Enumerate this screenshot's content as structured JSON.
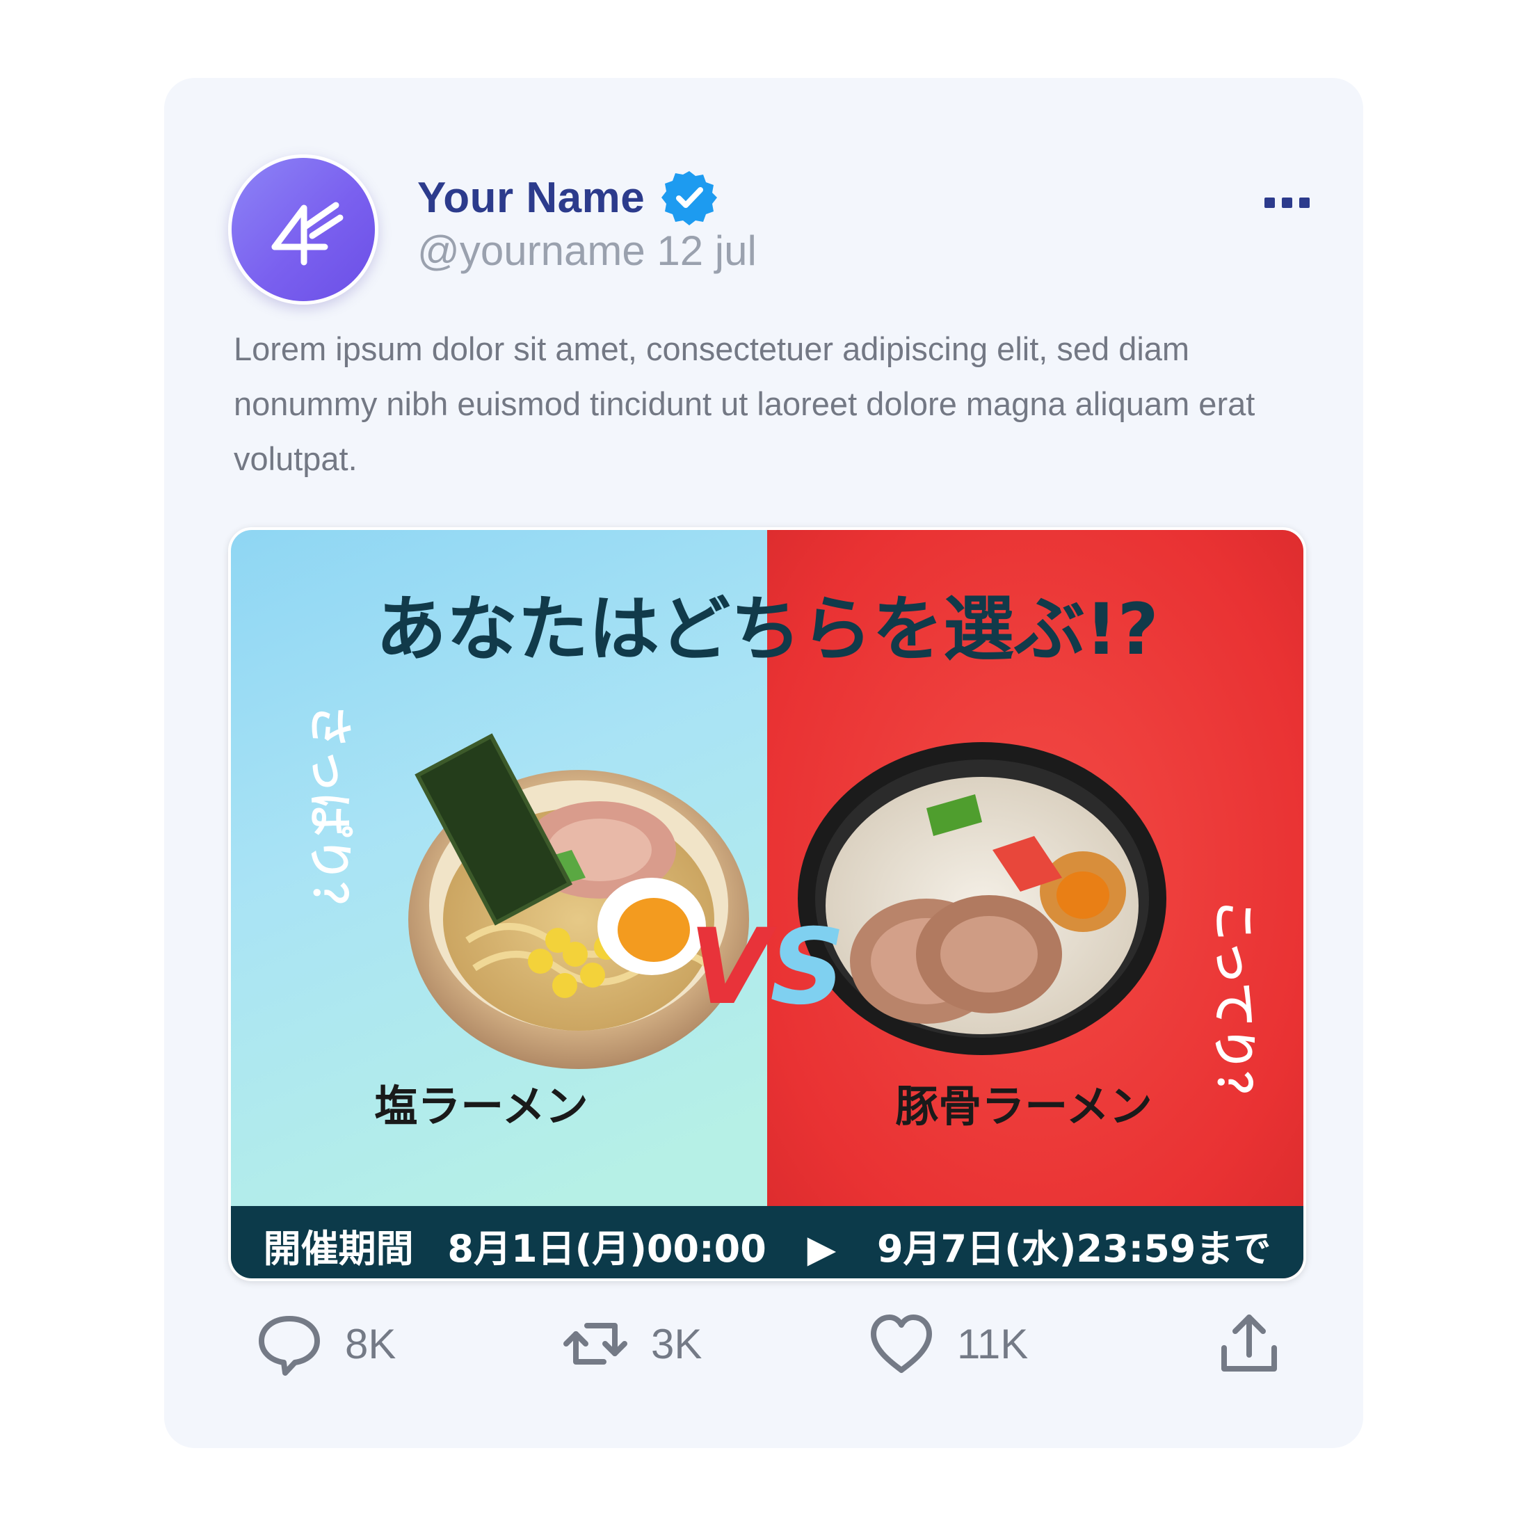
{
  "post": {
    "user_name": "Your Name",
    "handle_date": "@yourname 12 jul",
    "body": "Lorem ipsum dolor sit amet, consectetuer adipiscing elit, sed diam nonummy nibh euismod tincidunt ut laoreet dolore magna aliquam erat volutpat."
  },
  "image": {
    "headline": "あなたはどちらを選ぶ!?",
    "left_tagline": "さっぱり？",
    "right_tagline": "こってり？",
    "vs_label": "VS",
    "left_label": "塩ラーメン",
    "right_label": "豚骨ラーメン",
    "banner": {
      "period_label": "開催期間",
      "start": "8月1日(月)00:00",
      "arrow": "▶",
      "end": "9月7日(水)23:59まで"
    }
  },
  "actions": {
    "replies": "8K",
    "reposts": "3K",
    "likes": "11K"
  },
  "colors": {
    "card_bg": "#f3f6fc",
    "name": "#2c3b8c",
    "verified": "#1d9bf0",
    "left_panel": "#9fdcf2",
    "right_panel": "#ef3a3a",
    "banner": "#0c3a4a"
  },
  "icons": [
    "more-icon",
    "verified-badge-icon",
    "reply-icon",
    "repost-icon",
    "like-icon",
    "share-icon"
  ]
}
